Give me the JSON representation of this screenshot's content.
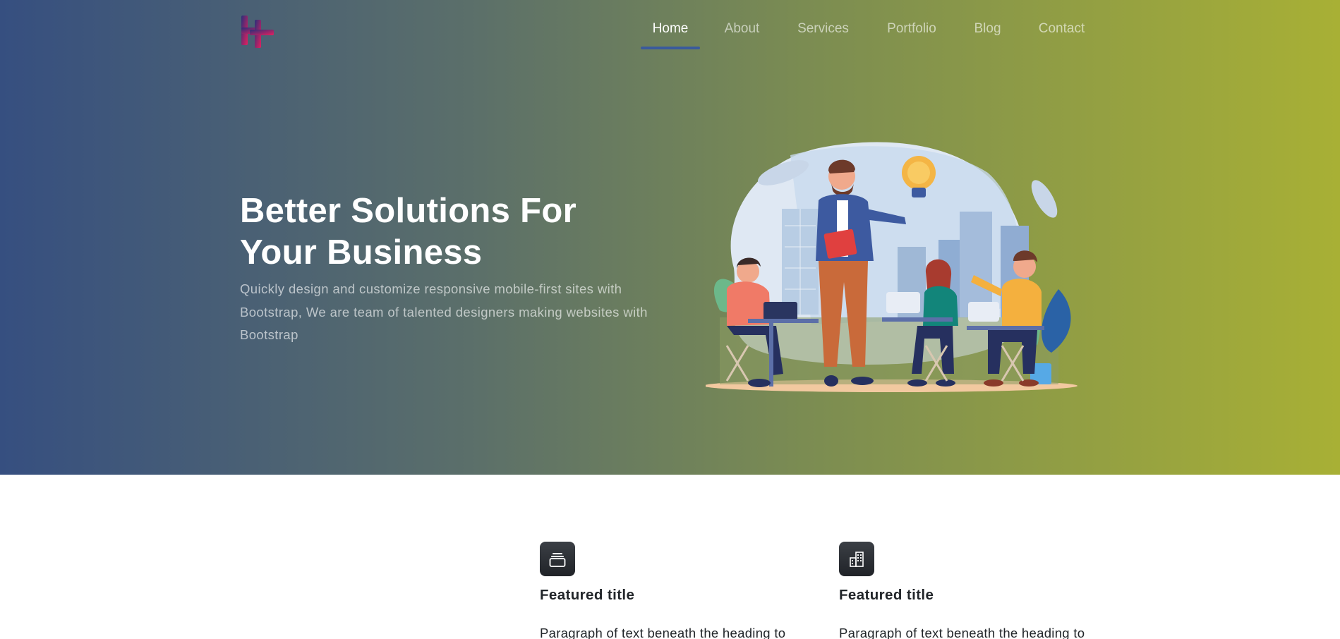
{
  "brand": {
    "logo_icon": "h-plus-logo-icon",
    "logo_colors": [
      "#2a2f7a",
      "#e4205f"
    ]
  },
  "nav": {
    "items": [
      {
        "label": "Home",
        "active": true
      },
      {
        "label": "About",
        "active": false
      },
      {
        "label": "Services",
        "active": false
      },
      {
        "label": "Portfolio",
        "active": false
      },
      {
        "label": "Blog",
        "active": false
      },
      {
        "label": "Contact",
        "active": false
      }
    ],
    "active_underline_color": "#3a5a9b"
  },
  "hero": {
    "title_line1": "Better Solutions For",
    "title_line2": "Your Business",
    "subtitle": "Quickly design and customize responsive mobile-first sites with Bootstrap, We are team of talented designers making websites with Bootstrap",
    "illustration": "team-meeting-illustration",
    "gradient_colors": [
      "#364f80",
      "#a8b035"
    ]
  },
  "features": [
    {
      "icon": "collection-icon",
      "title": "Featured title",
      "text": "Paragraph of text beneath the heading to"
    },
    {
      "icon": "building-icon",
      "title": "Featured title",
      "text": "Paragraph of text beneath the heading to"
    }
  ]
}
